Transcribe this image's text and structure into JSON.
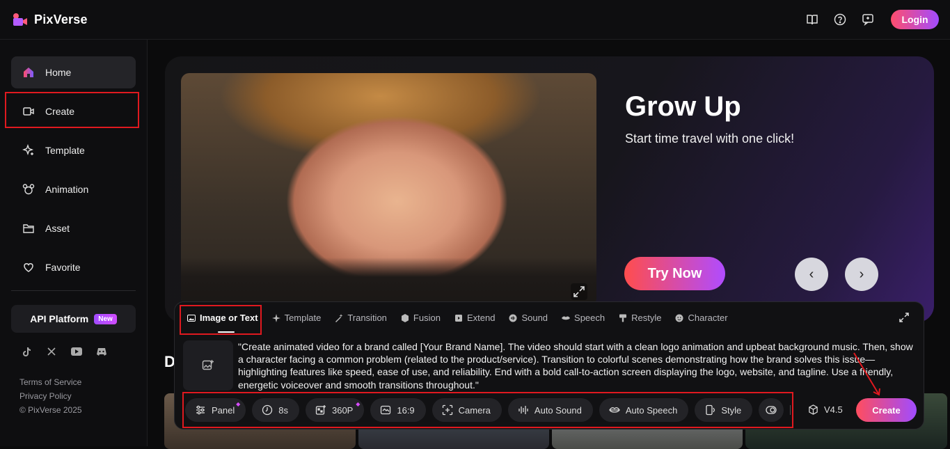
{
  "app": {
    "name": "PixVerse",
    "login_label": "Login"
  },
  "colors": {
    "accent_start": "#ff4d6d",
    "accent_end": "#a24cff",
    "annotation_red": "#e0191f"
  },
  "top_icons": [
    "book-icon",
    "help-icon",
    "feedback-icon"
  ],
  "sidebar": {
    "items": [
      {
        "label": "Home",
        "icon": "home-icon",
        "active": true
      },
      {
        "label": "Create",
        "icon": "video-icon",
        "active": false
      },
      {
        "label": "Template",
        "icon": "sparkle-icon",
        "active": false
      },
      {
        "label": "Animation",
        "icon": "mouse-ears-icon",
        "active": false
      },
      {
        "label": "Asset",
        "icon": "folder-icon",
        "active": false
      },
      {
        "label": "Favorite",
        "icon": "heart-icon",
        "active": false
      }
    ],
    "api_label": "API Platform",
    "api_badge": "New",
    "socials": [
      "tiktok-icon",
      "x-icon",
      "youtube-icon",
      "discord-icon"
    ],
    "footer": {
      "terms": "Terms of Service",
      "privacy": "Privacy Policy",
      "copyright": "© PixVerse 2025"
    }
  },
  "hero": {
    "title": "Grow Up",
    "subtitle": "Start time travel with one click!",
    "cta": "Try Now"
  },
  "panel": {
    "tabs": [
      "Image or Text",
      "Template",
      "Transition",
      "Fusion",
      "Extend",
      "Sound",
      "Speech",
      "Restyle",
      "Character"
    ],
    "prompt": "\"Create animated video for a brand called [Your Brand Name]. The video should start with a clean logo animation and upbeat background music. Then, show a character facing a common problem (related to the product/service). Transition to colorful scenes demonstrating how the brand solves this issue—highlighting features like speed, ease of use, and reliability. End with a bold call-to-action screen displaying the logo, website, and tagline. Use a friendly, energetic voiceover and smooth transitions throughout.\"",
    "toolbar": {
      "panel": "Panel",
      "duration": "8s",
      "resolution": "360P",
      "ratio": "16:9",
      "camera": "Camera",
      "auto_sound": "Auto Sound",
      "auto_speech": "Auto Speech",
      "style": "Style"
    },
    "model": "V4.5",
    "create": "Create"
  },
  "section_initial": "D"
}
